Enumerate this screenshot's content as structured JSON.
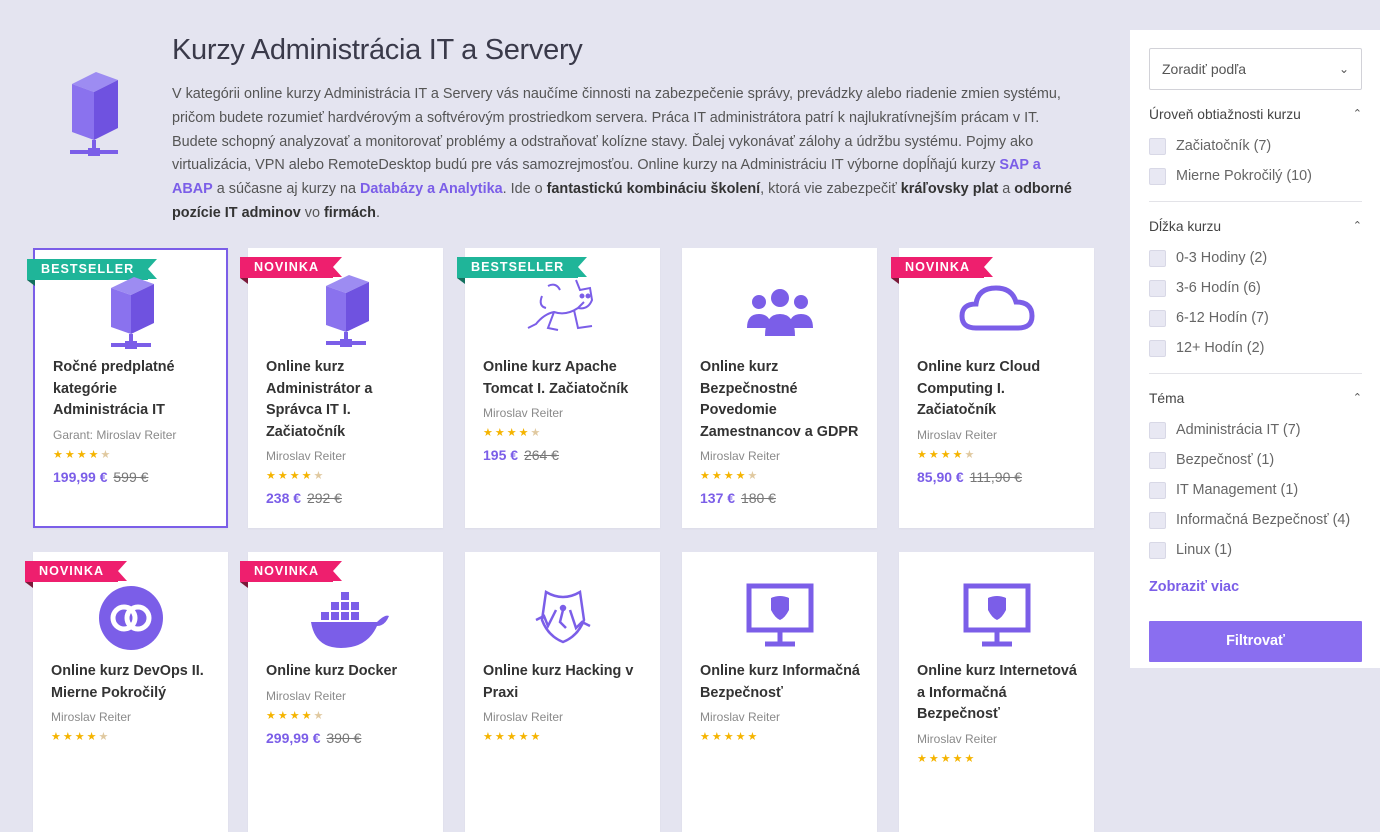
{
  "page": {
    "title": "Kurzy Administrácia IT a Servery",
    "intro": {
      "p1": "V kategórii online kurzy Administrácia IT a Servery vás naučíme činnosti na zabezpečenie správy, prevádzky alebo riadenie zmien systému, pričom budete rozumieť hardvérovým a softvérovým prostriedkom servera. Práca IT administrátora patrí k najlukratívnejším prácam v IT. Budete schopný analyzovať a monitorovať problémy a odstraňovať kolízne stavy. Ďalej vykonávať zálohy a údržbu systému. Pojmy ako virtualizácia, VPN alebo RemoteDesktop budú pre vás samozrejmosťou. Online kurzy na Administráciu IT výborne dopĺňajú kurzy ",
      "link1": "SAP a ABAP",
      "p2": " a súčasne aj kurzy na ",
      "link2": "Databázy a Analytika",
      "p3": ". Ide o ",
      "b1": "fantastickú kombináciu školení",
      "p4": ", ktorá vie zabezpečiť ",
      "b2": "kráľovsky plat",
      "p5": " a ",
      "b3": "odborné pozície IT adminov",
      "p6": " vo ",
      "b4": "firmách",
      "p7": "."
    }
  },
  "courses": [
    {
      "badge": "BESTSELLER",
      "badge_type": "best",
      "icon": "server-icon",
      "title": "Ročné predplatné kategórie Administrácia IT",
      "author": "Garant: Miroslav Reiter",
      "stars": "★★★★★",
      "rating": 4.5,
      "price": "199,99 €",
      "old_price": "599 €",
      "selected": true
    },
    {
      "badge": "NOVINKA",
      "badge_type": "new",
      "icon": "server-icon",
      "title": "Online kurz Administrátor a Správca IT I. Začiatočník",
      "author": "Miroslav Reiter",
      "stars": "★★★★★",
      "rating": 4.5,
      "price": "238 €",
      "old_price": "292 €"
    },
    {
      "badge": "BESTSELLER",
      "badge_type": "best",
      "icon": "tomcat-icon",
      "title": "Online kurz Apache Tomcat I. Začiatočník",
      "author": "Miroslav Reiter",
      "stars": "★★★★★",
      "rating": 4.5,
      "price": "195 €",
      "old_price": "264 €"
    },
    {
      "badge": "",
      "badge_type": "",
      "icon": "people-icon",
      "title": "Online kurz Bezpečnostné Povedomie Zamestnancov a GDPR",
      "author": "Miroslav Reiter",
      "stars": "★★★★★",
      "rating": 4.5,
      "price": "137 €",
      "old_price": "180 €"
    },
    {
      "badge": "NOVINKA",
      "badge_type": "new",
      "icon": "cloud-icon",
      "title": "Online kurz Cloud Computing I. Začiatočník",
      "author": "Miroslav Reiter",
      "stars": "★★★★★",
      "rating": 4.5,
      "price": "85,90 €",
      "old_price": "111,90 €"
    },
    {
      "badge": "NOVINKA",
      "badge_type": "new",
      "icon": "devops-icon",
      "title": "Online kurz DevOps II. Mierne Pokročilý",
      "author": "Miroslav Reiter",
      "stars": "★★★★★",
      "rating": 4.5,
      "price": "",
      "old_price": ""
    },
    {
      "badge": "NOVINKA",
      "badge_type": "new",
      "icon": "docker-icon",
      "title": "Online kurz Docker",
      "author": "Miroslav Reiter",
      "stars": "★★★★★",
      "rating": 4.5,
      "price": "299,99 €",
      "old_price": "390 €"
    },
    {
      "badge": "",
      "badge_type": "",
      "icon": "hacking-shield-icon",
      "title": "Online kurz Hacking v Praxi",
      "author": "Miroslav Reiter",
      "stars": "★★★★★",
      "rating": 5,
      "price": "",
      "old_price": ""
    },
    {
      "badge": "",
      "badge_type": "",
      "icon": "monitor-shield-icon",
      "title": "Online kurz Informačná Bezpečnosť",
      "author": "Miroslav Reiter",
      "stars": "★★★★★",
      "rating": 5,
      "price": "",
      "old_price": ""
    },
    {
      "badge": "",
      "badge_type": "",
      "icon": "monitor-shield-icon",
      "title": "Online kurz Internetová a Informačná Bezpečnosť",
      "author": "Miroslav Reiter",
      "stars": "★★★★★",
      "rating": 5,
      "price": "",
      "old_price": ""
    }
  ],
  "sidebar": {
    "sort_placeholder": "Zoradiť podľa",
    "sections": [
      {
        "title": "Úroveň obtiažnosti kurzu",
        "options": [
          "Začiatočník (7)",
          "Mierne Pokročilý (10)"
        ]
      },
      {
        "title": "Dĺžka kurzu",
        "options": [
          "0-3 Hodiny (2)",
          "3-6 Hodín (6)",
          "6-12 Hodín (7)",
          "12+ Hodín (2)"
        ]
      },
      {
        "title": "Téma",
        "options": [
          "Administrácia IT (7)",
          "Bezpečnosť (1)",
          "IT Management (1)",
          "Informačná Bezpečnosť (4)",
          "Linux (1)"
        ]
      }
    ],
    "show_more": "Zobraziť viac",
    "filter_button": "Filtrovať"
  },
  "colors": {
    "accent": "#7b5ee8",
    "bestseller": "#1fb599",
    "novinka": "#ee1f6e",
    "stars": "#f5b400",
    "background": "#e4e4f0"
  }
}
